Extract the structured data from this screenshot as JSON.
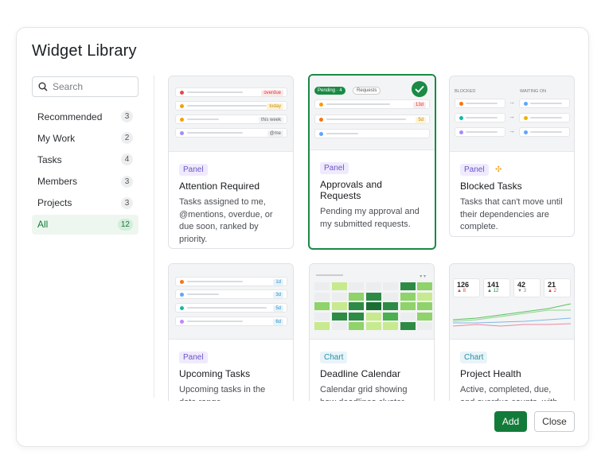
{
  "dialog": {
    "title": "Widget Library"
  },
  "search": {
    "placeholder": "Search"
  },
  "nav": [
    {
      "label": "Recommended",
      "count": "3"
    },
    {
      "label": "My Work",
      "count": "2"
    },
    {
      "label": "Tasks",
      "count": "4"
    },
    {
      "label": "Members",
      "count": "3"
    },
    {
      "label": "Projects",
      "count": "3"
    },
    {
      "label": "All",
      "count": "12"
    }
  ],
  "widgets": [
    {
      "tag": "Panel",
      "title": "Attention Required",
      "desc": "Tasks assigned to me, @mentions, overdue, or due soon, ranked by priority.",
      "thumb": {
        "pills": [
          "overdue",
          "today",
          "this week",
          "@me"
        ]
      }
    },
    {
      "tag": "Panel",
      "title": "Approvals and Requests",
      "desc": "Pending my approval and my submitted requests.",
      "thumb": {
        "tabs": [
          "Pending · 4",
          "Requests"
        ],
        "pills": [
          "13d",
          "5d"
        ]
      }
    },
    {
      "tag": "Panel",
      "title": "Blocked Tasks",
      "desc": "Tasks that can't move until their dependencies are complete.",
      "thumb": {
        "headers": [
          "BLOCKED",
          "WAITING ON"
        ]
      }
    },
    {
      "tag": "Panel",
      "title": "Upcoming Tasks",
      "desc": "Upcoming tasks in the date range.",
      "thumb": {
        "pills": [
          "1d",
          "3d",
          "5d",
          "6d"
        ]
      }
    },
    {
      "tag": "Chart",
      "title": "Deadline Calendar",
      "desc": "Calendar grid showing how deadlines cluster",
      "thumb": {}
    },
    {
      "tag": "Chart",
      "title": "Project Health",
      "desc": "Active, completed, due, and overdue counts, with",
      "thumb": {
        "stats": [
          {
            "value": "126",
            "delta": "▲ 8"
          },
          {
            "value": "141",
            "delta": "▲ 12"
          },
          {
            "value": "42",
            "delta": "▼ 3"
          },
          {
            "value": "21",
            "delta": "▲ 2"
          }
        ]
      }
    }
  ],
  "actions": {
    "add": "Add",
    "close": "Close"
  },
  "colors": {
    "accent": "#137b3a",
    "selected_border": "#1a8a44"
  }
}
